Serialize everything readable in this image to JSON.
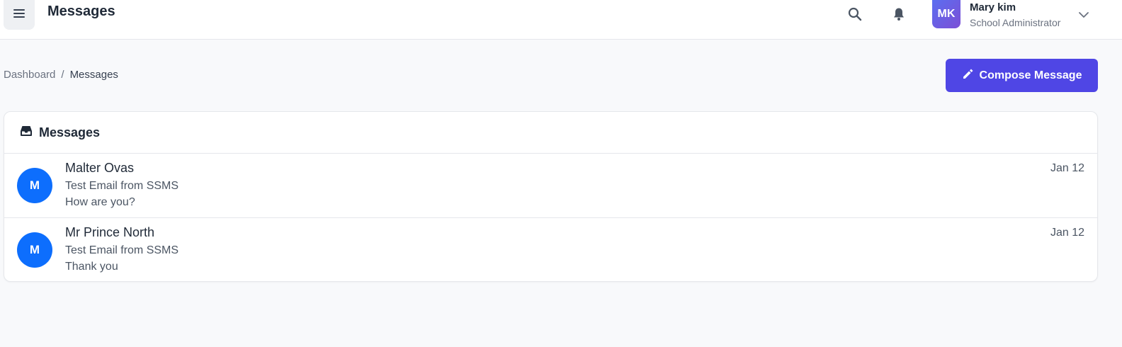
{
  "header": {
    "title": "Messages",
    "menu_icon": "hamburger-icon",
    "search_icon": "search-icon",
    "notification_icon": "bell-icon",
    "user": {
      "initials": "MK",
      "name": "Mary kim",
      "role": "School Administrator"
    }
  },
  "breadcrumb": {
    "items": [
      "Dashboard",
      "Messages"
    ],
    "separator": "/"
  },
  "compose": {
    "label": "Compose Message",
    "icon": "pencil-icon",
    "color": "#4f46e5"
  },
  "inbox": {
    "title": "Messages",
    "icon": "inbox-icon",
    "avatar_color": "#0d6efd",
    "messages": [
      {
        "initial": "M",
        "sender": "Malter Ovas",
        "subject": "Test Email from SSMS",
        "preview": "How are you?",
        "date": "Jan 12"
      },
      {
        "initial": "M",
        "sender": "Mr Prince North",
        "subject": "Test Email from SSMS",
        "preview": "Thank you",
        "date": "Jan 12"
      }
    ]
  }
}
